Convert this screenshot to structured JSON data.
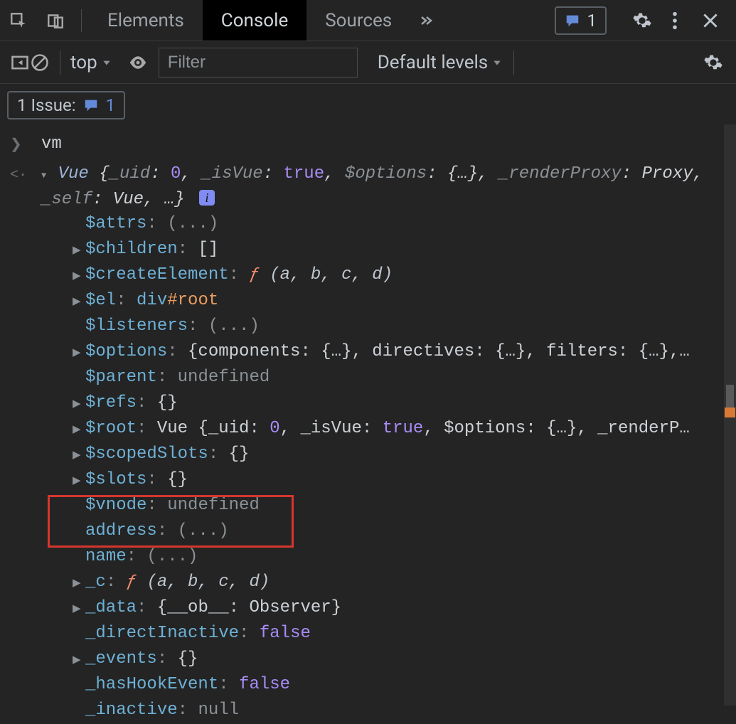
{
  "tabs": [
    "Elements",
    "Console",
    "Sources"
  ],
  "activeTab": 1,
  "pillCount": "1",
  "issues": {
    "label": "1 Issue:",
    "count": "1"
  },
  "contextLabel": "top",
  "filterPlaceholder": "Filter",
  "levelsLabel": "Default levels",
  "input": {
    "text": "vm"
  },
  "summary": {
    "lead": "Vue ",
    "body": "{_uid: 0, _isVue: true, $options: {…}, _renderProxy: Proxy, _self: Vue, …}"
  },
  "props": {
    "attrs": {
      "k": "$attrs",
      "v": "(...)",
      "exp": false
    },
    "children": {
      "k": "$children",
      "v": "[]",
      "exp": true
    },
    "createEl": {
      "k": "$createElement",
      "fsig": "(a, b, c, d)",
      "exp": true
    },
    "el": {
      "k": "$el",
      "tag": "div",
      "id": "#root",
      "exp": true
    },
    "listeners": {
      "k": "$listeners",
      "v": "(...)",
      "exp": false
    },
    "options": {
      "k": "$options",
      "v": "{components: {…}, directives: {…}, filters: {…},…",
      "exp": true
    },
    "parent": {
      "k": "$parent",
      "und": "undefined",
      "exp": false
    },
    "refs": {
      "k": "$refs",
      "v": "{}",
      "exp": true
    },
    "root": {
      "k": "$root",
      "v": "Vue {_uid: 0, _isVue: true, $options: {…}, _renderP…",
      "exp": true
    },
    "scoped": {
      "k": "$scopedSlots",
      "v": "{}",
      "exp": true
    },
    "slots": {
      "k": "$slots",
      "v": "{}",
      "exp": true
    },
    "vnode": {
      "k": "$vnode",
      "und": "undefined",
      "exp": false
    },
    "address": {
      "k": "address",
      "v": "(...)",
      "exp": false
    },
    "name": {
      "k": "name",
      "v": "(...)",
      "exp": false
    },
    "c": {
      "k": "_c",
      "fsig": "(a, b, c, d)",
      "exp": true
    },
    "data": {
      "k": "_data",
      "v": "{__ob__: Observer}",
      "exp": true
    },
    "di": {
      "k": "_directInactive",
      "b": "false",
      "exp": false
    },
    "events": {
      "k": "_events",
      "v": "{}",
      "exp": true
    },
    "hhe": {
      "k": "_hasHookEvent",
      "b": "false",
      "exp": false
    },
    "inactive": {
      "k": "_inactive",
      "null": "null",
      "exp": false
    }
  }
}
